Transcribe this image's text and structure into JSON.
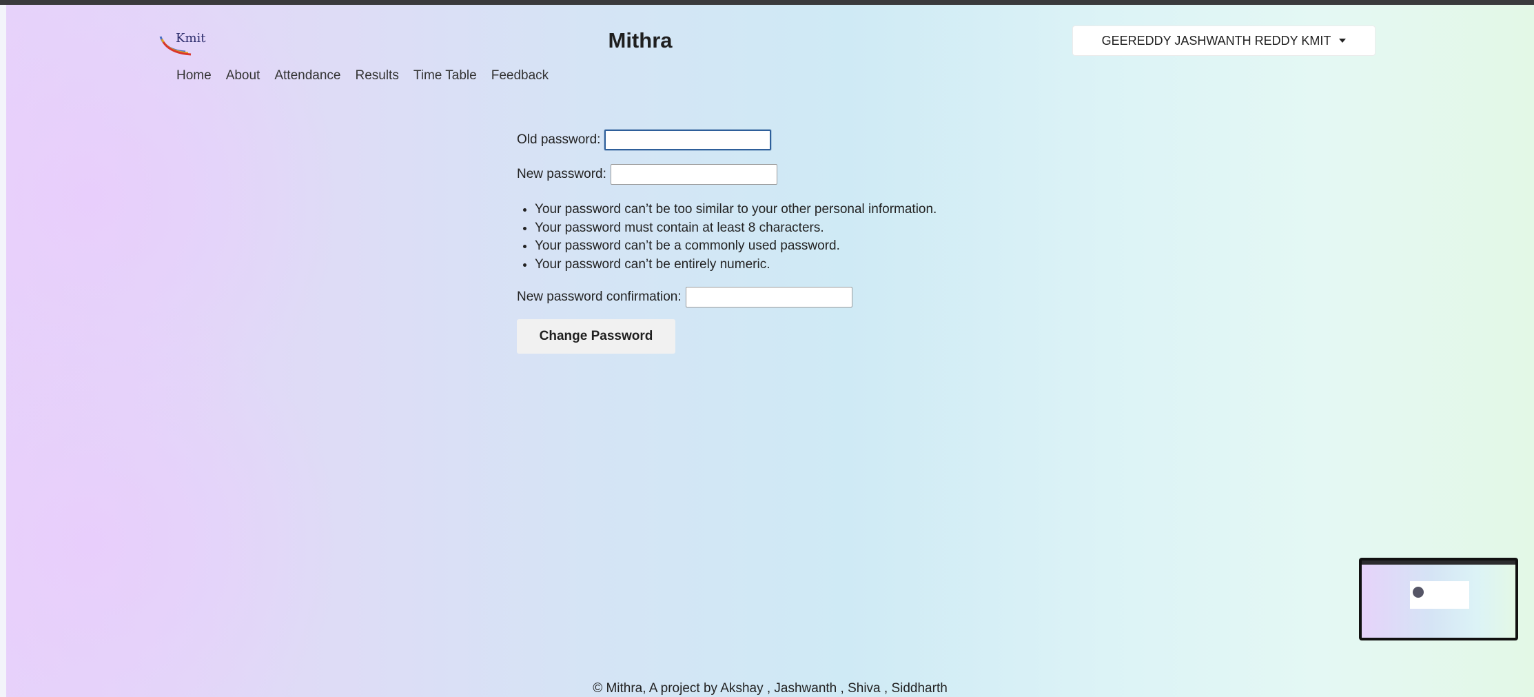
{
  "header": {
    "logo_text": "Kmit",
    "site_title": "Mithra",
    "user_menu_label": "GEEREDDY JASHWANTH REDDY KMIT"
  },
  "nav": {
    "items": [
      {
        "label": "Home"
      },
      {
        "label": "About"
      },
      {
        "label": "Attendance"
      },
      {
        "label": "Results"
      },
      {
        "label": "Time Table"
      },
      {
        "label": "Feedback"
      }
    ]
  },
  "form": {
    "old_password_label": "Old password:",
    "old_password_value": "",
    "new_password_label": "New password:",
    "new_password_value": "",
    "help_items": [
      "Your password can’t be too similar to your other personal information.",
      "Your password must contain at least 8 characters.",
      "Your password can’t be a commonly used password.",
      "Your password can’t be entirely numeric."
    ],
    "confirm_label": "New password confirmation:",
    "confirm_value": "",
    "submit_label": "Change Password"
  },
  "footer": {
    "text": "© Mithra, A project by Akshay , Jashwanth , Shiva , Siddharth"
  },
  "colors": {
    "accent_focus": "#2e5f9a",
    "gradient_left": "#e6d3fa",
    "gradient_middle": "#cfeaf5",
    "gradient_right": "#e3f8e6"
  }
}
